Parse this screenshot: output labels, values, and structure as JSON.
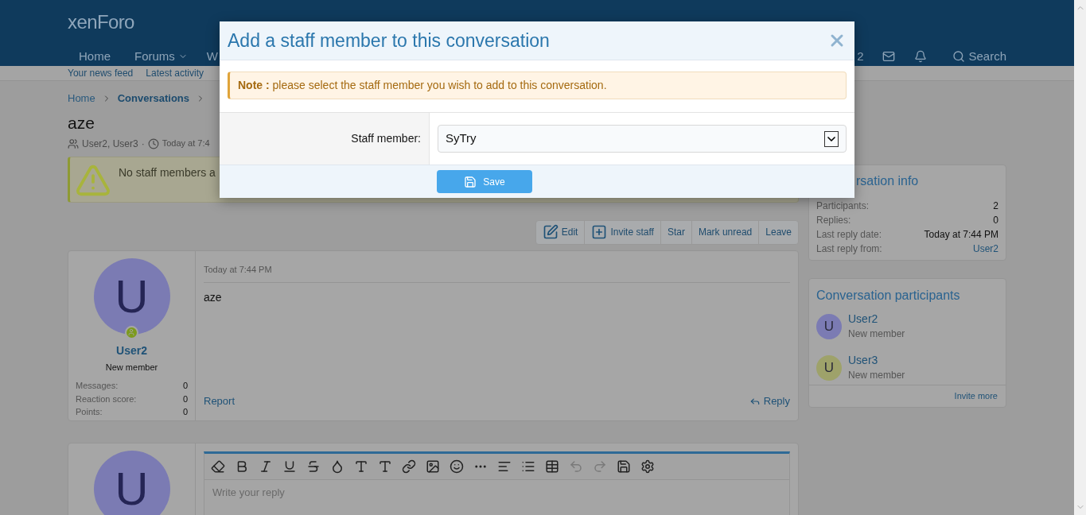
{
  "header": {
    "logo": "xenForo",
    "nav": [
      {
        "label": "Home",
        "dropdown": false
      },
      {
        "label": "Forums",
        "dropdown": true
      },
      {
        "label": "W",
        "dropdown": false
      }
    ],
    "user_fragment": "2",
    "search": "Search"
  },
  "subnav": [
    "Your news feed",
    "Latest activity"
  ],
  "breadcrumb": [
    {
      "label": "Home",
      "current": false
    },
    {
      "label": "Conversations",
      "current": true
    }
  ],
  "page_title": "aze",
  "meta": {
    "participants": "User2, User3",
    "separator": "·",
    "time": "Today at 7:4"
  },
  "notice": "No staff members a",
  "actions": [
    "Edit",
    "Invite staff",
    "Star",
    "Mark unread",
    "Leave"
  ],
  "message": {
    "avatar_letter": "U",
    "author": "User2",
    "role": "New member",
    "stats": [
      {
        "label": "Messages:",
        "value": "0"
      },
      {
        "label": "Reaction score:",
        "value": "0"
      },
      {
        "label": "Points:",
        "value": "0"
      }
    ],
    "time": "Today at 7:44 PM",
    "body": "aze",
    "report": "Report",
    "reply": "Reply"
  },
  "reply_editor": {
    "avatar_letter": "U",
    "placeholder": "Write your reply"
  },
  "conversation_info": {
    "title": "rsation info",
    "rows": [
      {
        "label": "Participants:",
        "value": "2",
        "link": false
      },
      {
        "label": "Replies:",
        "value": "0",
        "link": false
      },
      {
        "label": "Last reply date:",
        "value": "Today at 7:44 PM",
        "link": false
      },
      {
        "label": "Last reply from:",
        "value": "User2",
        "link": true
      }
    ]
  },
  "participants": {
    "title": "Conversation participants",
    "members": [
      {
        "name": "User2",
        "role": "New member",
        "letter": "U",
        "color": "#7b7bb3"
      },
      {
        "name": "User3",
        "role": "New member",
        "letter": "U",
        "color": "#9ea26a"
      }
    ],
    "invite": "Invite more"
  },
  "modal": {
    "title": "Add a staff member to this conversation",
    "note_label": "Note :",
    "note": "please select the staff member you wish to add to this conversation.",
    "field_label": "Staff member:",
    "value": "SyTry",
    "save": "Save"
  }
}
